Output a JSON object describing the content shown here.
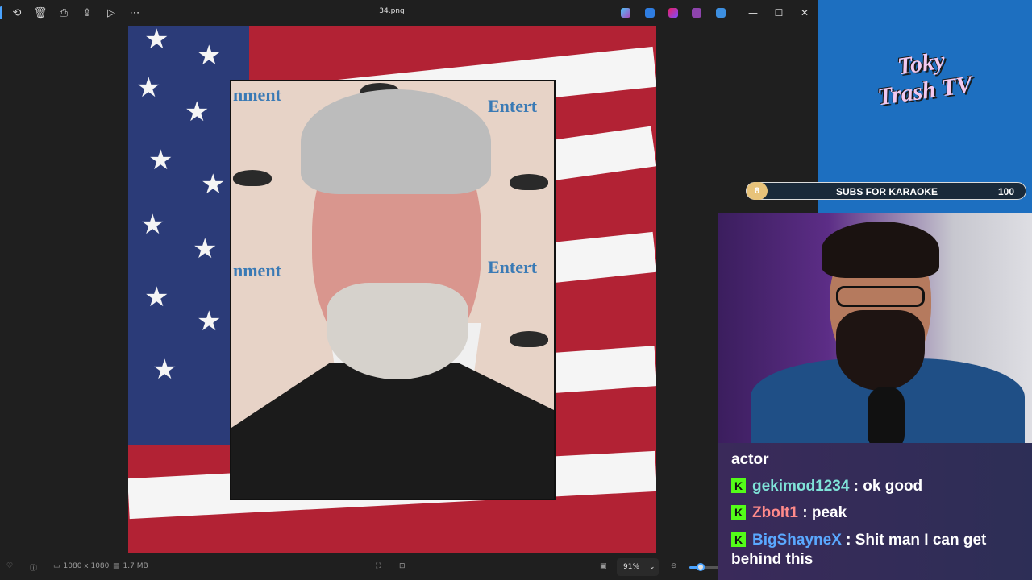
{
  "window": {
    "filename": "34.png",
    "toolbar": [
      "rotate-icon",
      "delete-icon",
      "print-icon",
      "share-icon",
      "slideshow-icon",
      "more-icon"
    ],
    "controls": {
      "minimize": "—",
      "maximize": "☐",
      "close": "✕"
    }
  },
  "statusbar": {
    "dimensions": "1080 x 1080",
    "filesize": "1.7 MB",
    "zoom": "91%",
    "zoom_fraction": 0.12
  },
  "overlay": {
    "brand": "Toky Trash TV",
    "goal": {
      "current": "8",
      "label": "SUBS FOR KARAOKE",
      "target": "100"
    }
  },
  "chat": [
    {
      "user": "",
      "text": "actor",
      "color": "#ffffff"
    },
    {
      "user": "gekimod1234",
      "text": " : ok good",
      "color": "#7fe3d8"
    },
    {
      "user": "Zbolt1",
      "text": " : peak",
      "color": "#ff8a8a"
    },
    {
      "user": "BigShayneX",
      "text": " : Shit man I can get behind this",
      "color": "#5aa8ff"
    }
  ],
  "colors": {
    "accent": "#4aa3ff",
    "kick_green": "#53fc18",
    "flag_red": "#b22234",
    "flag_blue": "#2b3b78"
  }
}
